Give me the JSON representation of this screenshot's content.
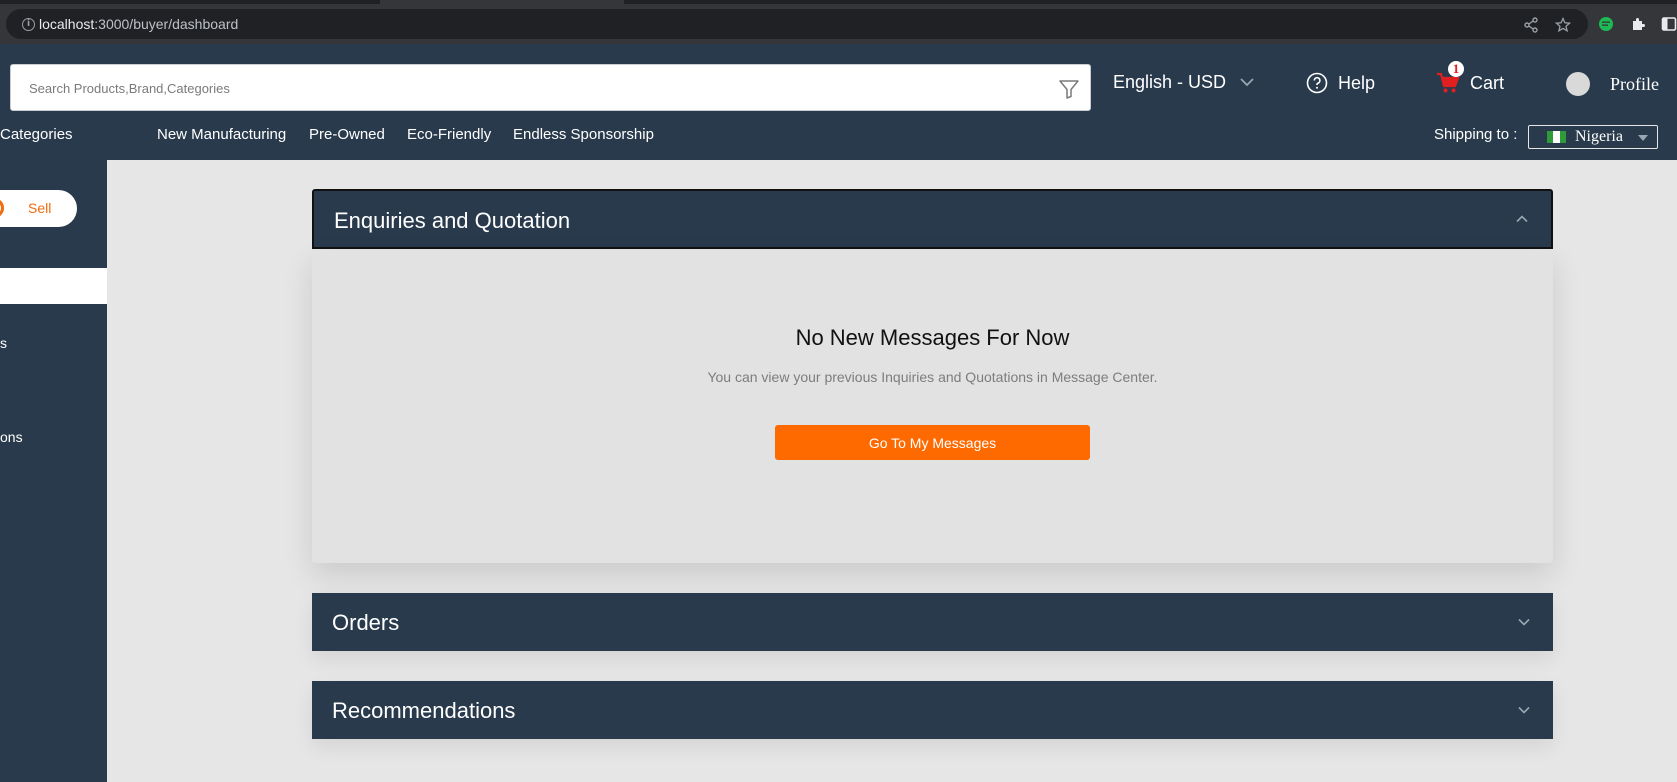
{
  "browser": {
    "url_host": "localhost",
    "url_path": ":3000/buyer/dashboard"
  },
  "header": {
    "search_placeholder": "Search Products,Brand,Categories",
    "language": "English - USD",
    "help": "Help",
    "cart_label": "Cart",
    "cart_count": "1",
    "profile": "Profile",
    "shipping_label": "Shipping to :",
    "country": "Nigeria",
    "flag_colors": [
      "#2e9a3a",
      "#ffffff",
      "#2e9a3a"
    ]
  },
  "nav": {
    "categories": "Categories",
    "items": [
      "New Manufacturing",
      "Pre-Owned",
      "Eco-Friendly",
      "Endless Sponsorship"
    ]
  },
  "sidebar": {
    "sell_label": "Sell",
    "items": [
      "s",
      "ons"
    ]
  },
  "main": {
    "enquiries_title": "Enquiries and Quotation",
    "empty_title": "No New Messages For Now",
    "empty_subtitle": "You can view your previous Inquiries and Quotations in Message Center.",
    "go_button": "Go To My Messages",
    "orders_title": "Orders",
    "recommendations_title": "Recommendations"
  },
  "colors": {
    "navy": "#283a4c",
    "accent": "#ff6a00"
  }
}
